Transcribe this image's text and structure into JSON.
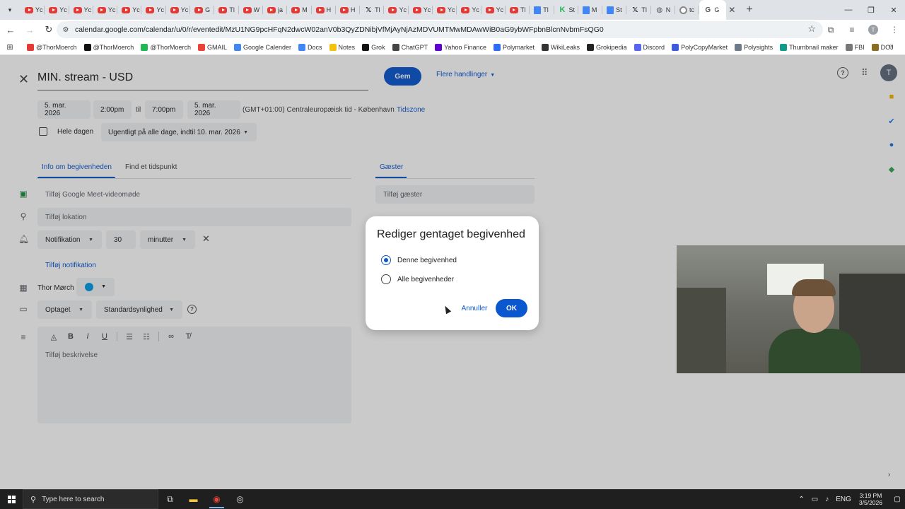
{
  "browser": {
    "tabs": [
      {
        "title": "Yc",
        "icon": "youtube-icon"
      },
      {
        "title": "Yc",
        "icon": "youtube-icon"
      },
      {
        "title": "Yc",
        "icon": "youtube-icon"
      },
      {
        "title": "Yc",
        "icon": "youtube-icon"
      },
      {
        "title": "Yc",
        "icon": "youtube-icon"
      },
      {
        "title": "Yc",
        "icon": "youtube-icon"
      },
      {
        "title": "Yc",
        "icon": "youtube-icon"
      },
      {
        "title": "G",
        "icon": "youtube-icon"
      },
      {
        "title": "Tl",
        "icon": "youtube-icon"
      },
      {
        "title": "W",
        "icon": "youtube-icon"
      },
      {
        "title": "ja",
        "icon": "youtube-icon"
      },
      {
        "title": "M",
        "icon": "youtube-icon"
      },
      {
        "title": "H",
        "icon": "youtube-icon"
      },
      {
        "title": "H",
        "icon": "youtube-icon"
      },
      {
        "title": "Tl",
        "icon": "x-icon"
      },
      {
        "title": "Yc",
        "icon": "youtube-icon"
      },
      {
        "title": "Yc",
        "icon": "youtube-icon"
      },
      {
        "title": "Yc",
        "icon": "youtube-icon"
      },
      {
        "title": "Yc",
        "icon": "youtube-icon"
      },
      {
        "title": "Yc",
        "icon": "youtube-icon"
      },
      {
        "title": "Tl",
        "icon": "youtube-icon"
      },
      {
        "title": "Tl",
        "icon": "docs-icon"
      },
      {
        "title": "St",
        "icon": "kick-icon"
      },
      {
        "title": "M",
        "icon": "docs-icon"
      },
      {
        "title": "St",
        "icon": "docs-icon"
      },
      {
        "title": "Tl",
        "icon": "x-icon"
      },
      {
        "title": "N",
        "icon": "globe-icon"
      },
      {
        "title": "tc",
        "icon": "chrome-icon"
      },
      {
        "title": "G",
        "icon": "calendar-icon",
        "active": true
      }
    ],
    "url": "calendar.google.com/calendar/u/0/r/eventedit/MzU1NG9pcHFqN2dwcW02anV0b3QyZDNibjVfMjAyNjAzMDVUMTMwMDAwWiB0aG9ybWFpbnBlcnNvbmFsQG0",
    "bookmarks": [
      {
        "label": "@ThorMoerch",
        "color": "#e53935"
      },
      {
        "label": "@ThorMoerch",
        "color": "#111111"
      },
      {
        "label": "@ThorMoerch",
        "color": "#1db954"
      },
      {
        "label": "GMAIL",
        "color": "#ea4335"
      },
      {
        "label": "Google Calender",
        "color": "#4285f4"
      },
      {
        "label": "Docs",
        "color": "#4285f4"
      },
      {
        "label": "Notes",
        "color": "#f4c20d"
      },
      {
        "label": "Grok",
        "color": "#111111"
      },
      {
        "label": "ChatGPT",
        "color": "#444444"
      },
      {
        "label": "Yahoo Finance",
        "color": "#5f01d1"
      },
      {
        "label": "Polymarket",
        "color": "#2d6bf5"
      },
      {
        "label": "WikiLeaks",
        "color": "#333333"
      },
      {
        "label": "Grokipedia",
        "color": "#222222"
      },
      {
        "label": "Discord",
        "color": "#5865f2"
      },
      {
        "label": "PolyCopyMarket",
        "color": "#3b5bdb"
      },
      {
        "label": "Polysights",
        "color": "#6c7a89"
      },
      {
        "label": "Thumbnail maker",
        "color": "#0f9d8a"
      },
      {
        "label": "FBI",
        "color": "#777777"
      },
      {
        "label": "DOJ",
        "color": "#8a6d1f"
      }
    ]
  },
  "event": {
    "close_icon": "close-icon",
    "title": "MIN. stream - USD",
    "save_label": "Gem",
    "more_actions_label": "Flere handlinger",
    "start_date": "5. mar. 2026",
    "start_time": "2:00pm",
    "to_label": "til",
    "end_time": "7:00pm",
    "end_date": "5. mar. 2026",
    "timezone": "(GMT+01:00) Centraleuropæisk tid - København",
    "timezone_link": "Tidszone",
    "allday_label": "Hele dagen",
    "repeat": "Ugentligt på alle dage, indtil 10. mar. 2026",
    "tab_info": "Info om begivenheden",
    "tab_find": "Find et tidspunkt",
    "meet_label": "Tilføj Google Meet-videomøde",
    "location_placeholder": "Tilføj lokation",
    "notification_type": "Notifikation",
    "notification_value": "30",
    "notification_unit": "minutter",
    "add_notification": "Tilføj notifikation",
    "owner_name": "Thor Mørch",
    "calendar_color": "#039be5",
    "busy_status": "Optaget",
    "visibility": "Standardsynlighed",
    "description_placeholder": "Tilføj beskrivelse",
    "guests_tab": "Gæster",
    "guests_placeholder": "Tilføj gæster",
    "account_initial": "T"
  },
  "dialog": {
    "title": "Rediger gentaget begivenhed",
    "option_this": "Denne begivenhed",
    "option_all": "Alle begivenheder",
    "selected": "option_this",
    "cancel_label": "Annuller",
    "ok_label": "OK"
  },
  "taskbar": {
    "search_placeholder": "Type here to search",
    "language": "ENG",
    "time": "3:19 PM",
    "date": "3/5/2026"
  },
  "colors": {
    "primary": "#0b57d0",
    "overlay": "rgba(32,33,36,0.24)"
  }
}
